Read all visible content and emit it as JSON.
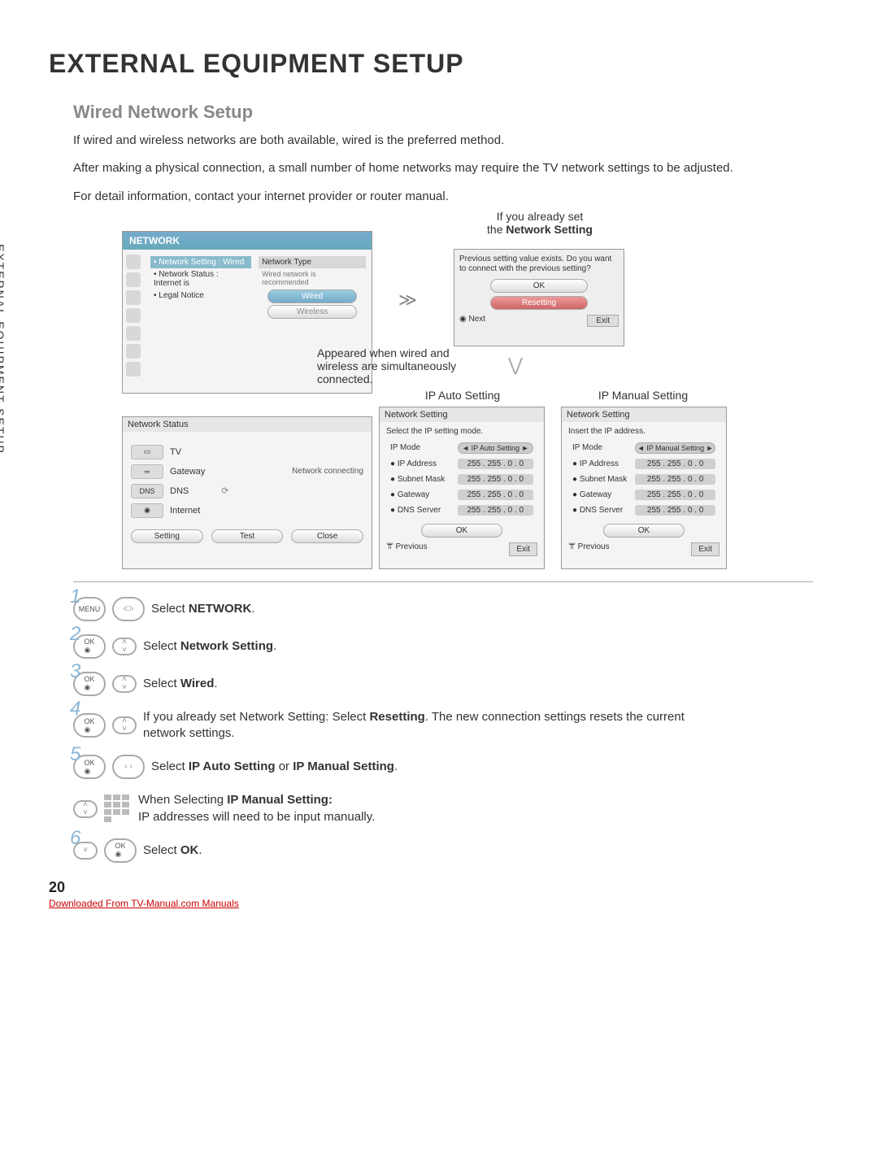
{
  "page_number": "20",
  "side_label": "EXTERNAL EQUIPMENT SETUP",
  "title": "EXTERNAL EQUIPMENT SETUP",
  "subtitle": "Wired Network Setup",
  "intro_lines": [
    "If wired and wireless networks are both available, wired is the preferred method.",
    "After making a physical connection, a small number of home networks may require the TV network settings to be adjusted.",
    "For detail information, contact your internet provider or router manual."
  ],
  "network_panel": {
    "header": "NETWORK",
    "items": [
      {
        "label": "Network Setting",
        "value": ": Wired"
      },
      {
        "label": "Network Status",
        "value": ": Internet is"
      },
      {
        "label": "Legal Notice",
        "value": ""
      }
    ],
    "right_title": "Network Type",
    "right_sub": "Wired network is recommended",
    "opt_wired": "Wired",
    "opt_wireless": "Wireless"
  },
  "type_note": "Appeared when wired and wireless are simultaneously connected.",
  "existing": {
    "caption1": "If you already set",
    "caption2": "the ",
    "caption2b": "Network Setting",
    "text": "Previous setting value exists. Do you want to connect with the previous setting?",
    "ok": "OK",
    "resetting": "Resetting",
    "next": "Next",
    "exit": "Exit"
  },
  "ipauto_caption": "IP Auto Setting",
  "ipman_caption": "IP Manual Setting",
  "ipauto": {
    "hdr": "Network Setting",
    "sub": "Select the IP setting mode.",
    "mode_label": "IP Mode",
    "mode_val": "◄ IP Auto Setting ►",
    "rows": [
      {
        "k": "IP Address",
        "v": "255 . 255 . 0 . 0"
      },
      {
        "k": "Subnet Mask",
        "v": "255 . 255 . 0 . 0"
      },
      {
        "k": "Gateway",
        "v": "255 . 255 . 0 . 0"
      },
      {
        "k": "DNS Server",
        "v": "255 . 255 . 0 . 0"
      }
    ],
    "ok": "OK",
    "prev": "Previous",
    "exit": "Exit"
  },
  "ipman": {
    "hdr": "Network Setting",
    "sub": "Insert the IP address.",
    "mode_label": "IP Mode",
    "mode_val": "◄ IP Manual Setting ►",
    "rows": [
      {
        "k": "IP Address",
        "v": "255 . 255 . 0 . 0"
      },
      {
        "k": "Subnet Mask",
        "v": "255 . 255 . 0 . 0"
      },
      {
        "k": "Gateway",
        "v": "255 . 255 . 0 . 0"
      },
      {
        "k": "DNS Server",
        "v": "255 . 255 . 0 . 0"
      }
    ],
    "ok": "OK",
    "prev": "Previous",
    "exit": "Exit"
  },
  "status": {
    "hdr": "Network Status",
    "tv": "TV",
    "gateway": "Gateway",
    "dns": "DNS",
    "internet": "Internet",
    "connecting": "Network connecting",
    "setting": "Setting",
    "test": "Test",
    "close": "Close"
  },
  "steps": [
    {
      "n": "1",
      "btn": "MENU",
      "aux": "nav",
      "pre": "Select ",
      "bold": "NETWORK",
      "post": "."
    },
    {
      "n": "2",
      "btn": "OK",
      "aux": "ud",
      "pre": "Select ",
      "bold": "Network Setting",
      "post": "."
    },
    {
      "n": "3",
      "btn": "OK",
      "aux": "ud",
      "pre": "Select ",
      "bold": "Wired",
      "post": "."
    },
    {
      "n": "4",
      "btn": "OK",
      "aux": "ud",
      "pre": "If you already set Network Setting: Select ",
      "bold": "Resetting",
      "post": ". The new connection settings resets the current network settings."
    },
    {
      "n": "5",
      "btn": "OK",
      "aux": "nav",
      "pre": "Select ",
      "bold": "IP Auto Setting",
      "post": " or ",
      "bold2": "IP Manual Setting",
      "post2": "."
    },
    {
      "n": "",
      "btn": "ud",
      "aux": "pad",
      "pre": "When Selecting ",
      "bold": "IP Manual Setting:",
      "post": "",
      "line2": "IP addresses will need to be input manually."
    },
    {
      "n": "6",
      "btn": "d",
      "aux": "OK",
      "pre": "Select ",
      "bold": "OK",
      "post": "."
    }
  ],
  "footer_link": "Downloaded From TV-Manual.com Manuals"
}
